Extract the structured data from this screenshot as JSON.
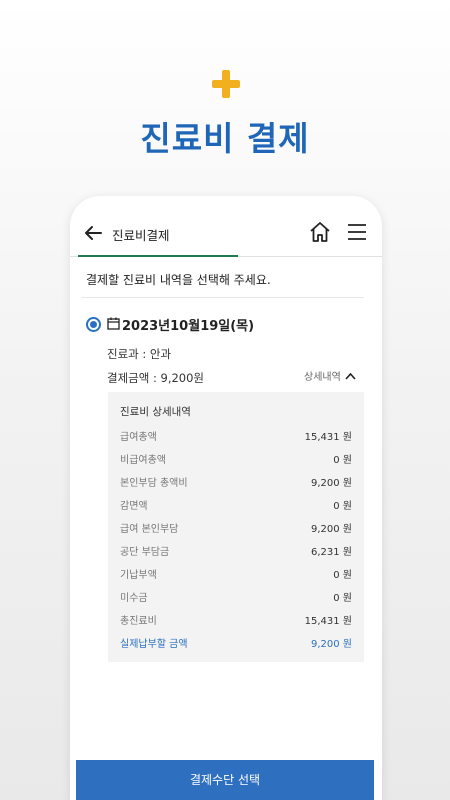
{
  "banner": {
    "title": "진료비 결제"
  },
  "header": {
    "title": "진료비결제"
  },
  "intro": "결제할 진료비 내역을 선택해 주세요.",
  "visit": {
    "date": "2023년10월19일(목)",
    "department": "진료과 : 안과",
    "amount": "결제금액 : 9,200원",
    "details_toggle": "상세내역"
  },
  "detail": {
    "title": "진료비 상세내역",
    "rows": [
      {
        "label": "급여총액",
        "value": "15,431 원"
      },
      {
        "label": "비급여총액",
        "value": "0 원"
      },
      {
        "label": "본인부담 총액비",
        "value": "9,200 원"
      },
      {
        "label": "감면액",
        "value": "0 원"
      },
      {
        "label": "급여 본인부담",
        "value": "9,200 원"
      },
      {
        "label": "공단 부담금",
        "value": "6,231 원"
      },
      {
        "label": "기납부액",
        "value": "0 원"
      },
      {
        "label": "미수금",
        "value": "0 원"
      },
      {
        "label": "총진료비",
        "value": "15,431 원"
      },
      {
        "label": "실제납부할 금액",
        "value": "9,200 원"
      }
    ]
  },
  "cta": {
    "label": "결제수단 선택"
  },
  "colors": {
    "accent": "#2a70c2",
    "plus": "#f2b01e",
    "tab_underline": "#1e7a4f",
    "button": "#2f6fbf"
  },
  "icons": [
    "plus-icon",
    "back-arrow-icon",
    "home-icon",
    "menu-icon",
    "radio-selected-icon",
    "calendar-icon",
    "chevron-up-icon"
  ]
}
